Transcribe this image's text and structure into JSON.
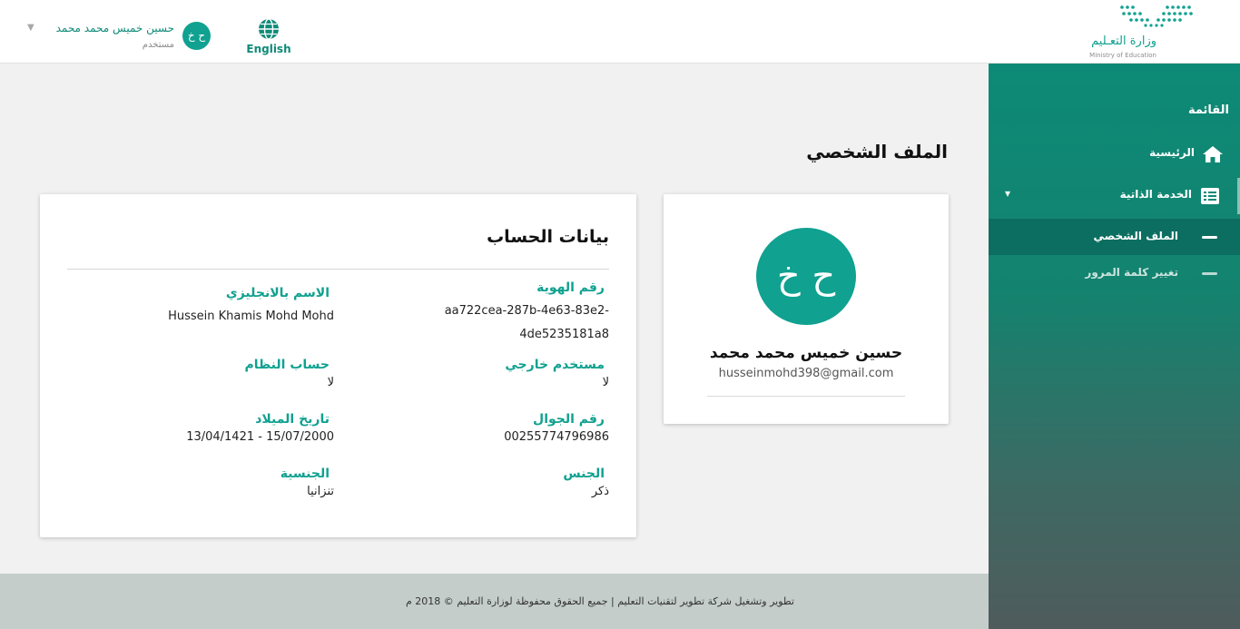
{
  "header": {
    "user": {
      "name": "حسين خميس محمد محمد",
      "role": "مستخدم",
      "initials": "ح خ"
    },
    "language_label": "English",
    "logo": {
      "arabic": "وزارة التعـليم",
      "english": "Ministry of Education"
    }
  },
  "sidebar": {
    "title": "القائمة",
    "items": [
      {
        "label": "الرئيسية",
        "icon": "home-icon"
      },
      {
        "label": "الخدمة الذاتية",
        "icon": "list-icon",
        "expanded": true
      }
    ],
    "sub_items": [
      {
        "label": "الملف الشخصي",
        "active": true
      },
      {
        "label": "تغيير كلمة المرور",
        "active": false
      }
    ]
  },
  "main": {
    "page_title": "الملف الشخصي",
    "profile": {
      "initials": "ح خ",
      "name": "حسين خميس محمد محمد",
      "email": "husseinmohd398@gmail.com"
    },
    "account": {
      "title": "بيانات الحساب",
      "fields": {
        "id_number": {
          "label": "رقم الهوية",
          "value_line1": "aa722cea-287b-4e63-83e2-",
          "value_line2": "4de5235181a8"
        },
        "english_name": {
          "label": "الاسم بالانجليزي",
          "value": "Hussein Khamis Mohd Mohd"
        },
        "external_user": {
          "label": "مستخدم خارجي",
          "value": "لا"
        },
        "system_account": {
          "label": "حساب النظام",
          "value": "لا"
        },
        "mobile": {
          "label": "رقم الجوال",
          "value": "00255774796986"
        },
        "birth_date": {
          "label": "تاريخ الميلاد",
          "value": "13/04/1421 - 15/07/2000"
        },
        "gender": {
          "label": "الجنس",
          "value": "ذكر"
        },
        "nationality": {
          "label": "الجنسية",
          "value": "تنزانيا"
        }
      }
    }
  },
  "footer": {
    "text": "تطوير وتشغيل شركة تطوير لتقنيات التعليم | جميع الحقوق محفوظة لوزارة التعليم © 2018 م"
  },
  "colors": {
    "accent": "#10a190",
    "sidebar_top": "#0d8a77",
    "sidebar_bottom": "#4f5b5c",
    "footer": "#c4cdc9"
  }
}
